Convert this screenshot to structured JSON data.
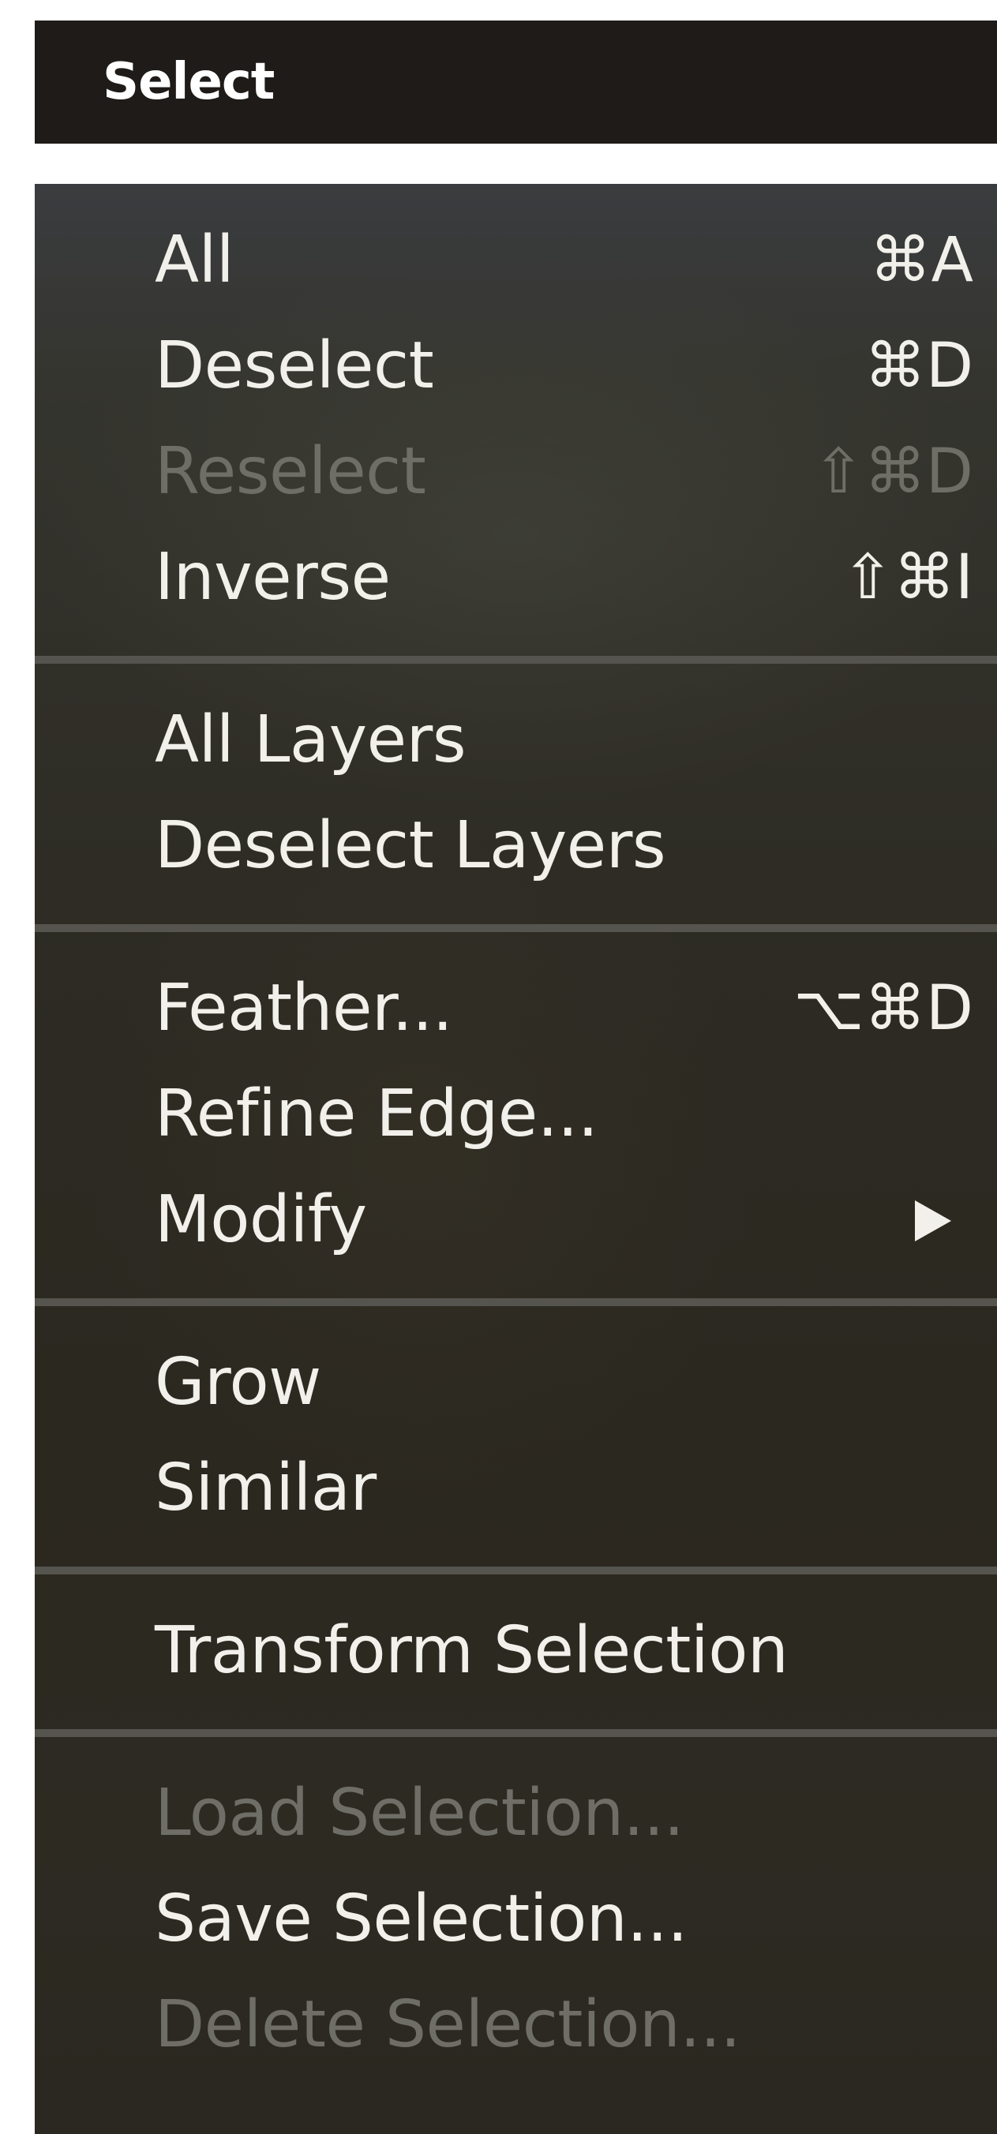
{
  "menubar": {
    "title": "Select"
  },
  "menu": {
    "groups": [
      {
        "items": [
          {
            "label": "All",
            "shortcut": "⌘A",
            "enabled": true
          },
          {
            "label": "Deselect",
            "shortcut": "⌘D",
            "enabled": true
          },
          {
            "label": "Reselect",
            "shortcut": "⇧⌘D",
            "enabled": false
          },
          {
            "label": "Inverse",
            "shortcut": "⇧⌘I",
            "enabled": true
          }
        ]
      },
      {
        "items": [
          {
            "label": "All Layers",
            "shortcut": "",
            "enabled": true
          },
          {
            "label": "Deselect Layers",
            "shortcut": "",
            "enabled": true
          }
        ]
      },
      {
        "items": [
          {
            "label": "Feather...",
            "shortcut": "⌥⌘D",
            "enabled": true
          },
          {
            "label": "Refine Edge...",
            "shortcut": "",
            "enabled": true
          },
          {
            "label": "Modify",
            "shortcut": "",
            "enabled": true,
            "submenu": true
          }
        ]
      },
      {
        "items": [
          {
            "label": "Grow",
            "shortcut": "",
            "enabled": true
          },
          {
            "label": "Similar",
            "shortcut": "",
            "enabled": true
          }
        ]
      },
      {
        "items": [
          {
            "label": "Transform Selection",
            "shortcut": "",
            "enabled": true
          }
        ]
      },
      {
        "items": [
          {
            "label": "Load Selection...",
            "shortcut": "",
            "enabled": false
          },
          {
            "label": "Save Selection...",
            "shortcut": "",
            "enabled": true
          },
          {
            "label": "Delete Selection...",
            "shortcut": "",
            "enabled": false
          }
        ]
      }
    ]
  },
  "colors": {
    "menubar_bg": "#1e1b19",
    "menu_text": "#f2f0ea",
    "menu_text_disabled": "#6e6e66",
    "separator": "#55544e"
  },
  "icons": {
    "submenu": "submenu-arrow-icon"
  }
}
